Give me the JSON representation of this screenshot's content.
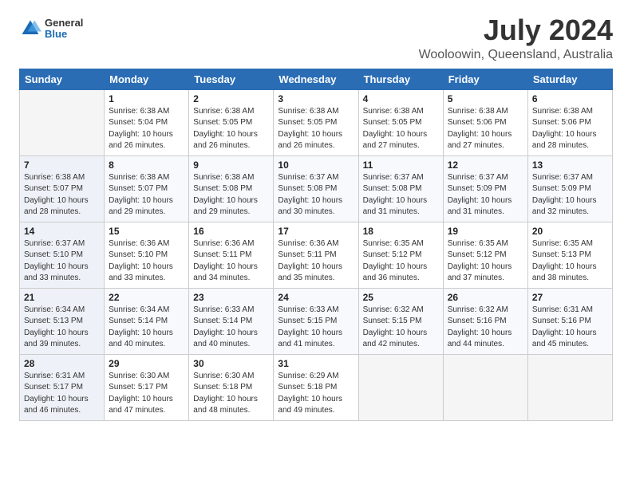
{
  "header": {
    "logo_general": "General",
    "logo_blue": "Blue",
    "title": "July 2024",
    "subtitle": "Wooloowin, Queensland, Australia"
  },
  "weekdays": [
    "Sunday",
    "Monday",
    "Tuesday",
    "Wednesday",
    "Thursday",
    "Friday",
    "Saturday"
  ],
  "weeks": [
    [
      {
        "day": "",
        "info": ""
      },
      {
        "day": "1",
        "info": "Sunrise: 6:38 AM\nSunset: 5:04 PM\nDaylight: 10 hours\nand 26 minutes."
      },
      {
        "day": "2",
        "info": "Sunrise: 6:38 AM\nSunset: 5:05 PM\nDaylight: 10 hours\nand 26 minutes."
      },
      {
        "day": "3",
        "info": "Sunrise: 6:38 AM\nSunset: 5:05 PM\nDaylight: 10 hours\nand 26 minutes."
      },
      {
        "day": "4",
        "info": "Sunrise: 6:38 AM\nSunset: 5:05 PM\nDaylight: 10 hours\nand 27 minutes."
      },
      {
        "day": "5",
        "info": "Sunrise: 6:38 AM\nSunset: 5:06 PM\nDaylight: 10 hours\nand 27 minutes."
      },
      {
        "day": "6",
        "info": "Sunrise: 6:38 AM\nSunset: 5:06 PM\nDaylight: 10 hours\nand 28 minutes."
      }
    ],
    [
      {
        "day": "7",
        "info": "Sunrise: 6:38 AM\nSunset: 5:07 PM\nDaylight: 10 hours\nand 28 minutes."
      },
      {
        "day": "8",
        "info": "Sunrise: 6:38 AM\nSunset: 5:07 PM\nDaylight: 10 hours\nand 29 minutes."
      },
      {
        "day": "9",
        "info": "Sunrise: 6:38 AM\nSunset: 5:08 PM\nDaylight: 10 hours\nand 29 minutes."
      },
      {
        "day": "10",
        "info": "Sunrise: 6:37 AM\nSunset: 5:08 PM\nDaylight: 10 hours\nand 30 minutes."
      },
      {
        "day": "11",
        "info": "Sunrise: 6:37 AM\nSunset: 5:08 PM\nDaylight: 10 hours\nand 31 minutes."
      },
      {
        "day": "12",
        "info": "Sunrise: 6:37 AM\nSunset: 5:09 PM\nDaylight: 10 hours\nand 31 minutes."
      },
      {
        "day": "13",
        "info": "Sunrise: 6:37 AM\nSunset: 5:09 PM\nDaylight: 10 hours\nand 32 minutes."
      }
    ],
    [
      {
        "day": "14",
        "info": "Sunrise: 6:37 AM\nSunset: 5:10 PM\nDaylight: 10 hours\nand 33 minutes."
      },
      {
        "day": "15",
        "info": "Sunrise: 6:36 AM\nSunset: 5:10 PM\nDaylight: 10 hours\nand 33 minutes."
      },
      {
        "day": "16",
        "info": "Sunrise: 6:36 AM\nSunset: 5:11 PM\nDaylight: 10 hours\nand 34 minutes."
      },
      {
        "day": "17",
        "info": "Sunrise: 6:36 AM\nSunset: 5:11 PM\nDaylight: 10 hours\nand 35 minutes."
      },
      {
        "day": "18",
        "info": "Sunrise: 6:35 AM\nSunset: 5:12 PM\nDaylight: 10 hours\nand 36 minutes."
      },
      {
        "day": "19",
        "info": "Sunrise: 6:35 AM\nSunset: 5:12 PM\nDaylight: 10 hours\nand 37 minutes."
      },
      {
        "day": "20",
        "info": "Sunrise: 6:35 AM\nSunset: 5:13 PM\nDaylight: 10 hours\nand 38 minutes."
      }
    ],
    [
      {
        "day": "21",
        "info": "Sunrise: 6:34 AM\nSunset: 5:13 PM\nDaylight: 10 hours\nand 39 minutes."
      },
      {
        "day": "22",
        "info": "Sunrise: 6:34 AM\nSunset: 5:14 PM\nDaylight: 10 hours\nand 40 minutes."
      },
      {
        "day": "23",
        "info": "Sunrise: 6:33 AM\nSunset: 5:14 PM\nDaylight: 10 hours\nand 40 minutes."
      },
      {
        "day": "24",
        "info": "Sunrise: 6:33 AM\nSunset: 5:15 PM\nDaylight: 10 hours\nand 41 minutes."
      },
      {
        "day": "25",
        "info": "Sunrise: 6:32 AM\nSunset: 5:15 PM\nDaylight: 10 hours\nand 42 minutes."
      },
      {
        "day": "26",
        "info": "Sunrise: 6:32 AM\nSunset: 5:16 PM\nDaylight: 10 hours\nand 44 minutes."
      },
      {
        "day": "27",
        "info": "Sunrise: 6:31 AM\nSunset: 5:16 PM\nDaylight: 10 hours\nand 45 minutes."
      }
    ],
    [
      {
        "day": "28",
        "info": "Sunrise: 6:31 AM\nSunset: 5:17 PM\nDaylight: 10 hours\nand 46 minutes."
      },
      {
        "day": "29",
        "info": "Sunrise: 6:30 AM\nSunset: 5:17 PM\nDaylight: 10 hours\nand 47 minutes."
      },
      {
        "day": "30",
        "info": "Sunrise: 6:30 AM\nSunset: 5:18 PM\nDaylight: 10 hours\nand 48 minutes."
      },
      {
        "day": "31",
        "info": "Sunrise: 6:29 AM\nSunset: 5:18 PM\nDaylight: 10 hours\nand 49 minutes."
      },
      {
        "day": "",
        "info": ""
      },
      {
        "day": "",
        "info": ""
      },
      {
        "day": "",
        "info": ""
      }
    ]
  ]
}
